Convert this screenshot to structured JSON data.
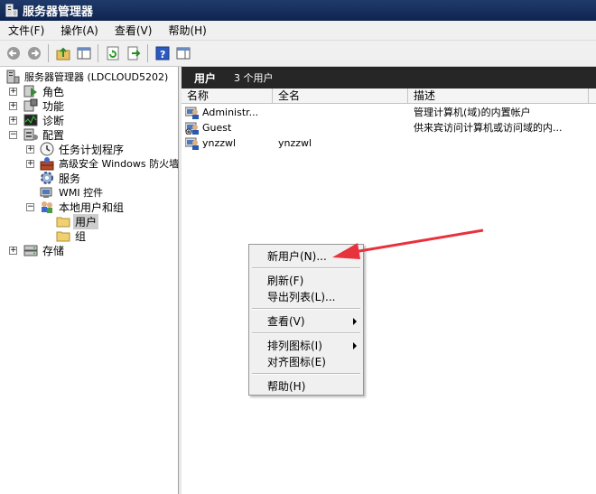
{
  "window": {
    "title": "服务器管理器"
  },
  "menubar": [
    {
      "id": "file",
      "label": "文件(F)"
    },
    {
      "id": "action",
      "label": "操作(A)"
    },
    {
      "id": "view",
      "label": "查看(V)"
    },
    {
      "id": "help",
      "label": "帮助(H)"
    }
  ],
  "toolbar": {
    "buttons": [
      "back-arrow-icon",
      "forward-arrow-icon",
      "up-folder-icon",
      "show-hide-tree-icon",
      "refresh-icon",
      "export-icon",
      "help-icon",
      "properties-icon"
    ]
  },
  "tree": {
    "root": "服务器管理器 (LDCLOUD5202)",
    "items": {
      "roles": "角色",
      "features": "功能",
      "diagnostics": "诊断",
      "configuration": "配置",
      "task_scheduler": "任务计划程序",
      "firewall": "高级安全 Windows 防火墙",
      "services": "服务",
      "wmi": "WMI 控件",
      "local_users_groups": "本地用户和组",
      "users": "用户",
      "groups": "组",
      "storage": "存储"
    }
  },
  "pane": {
    "title": "用户",
    "count": "3 个用户",
    "columns": {
      "name": "名称",
      "fullname": "全名",
      "description": "描述"
    },
    "rows": [
      {
        "name": "Administr...",
        "fullname": "",
        "description": "管理计算机(域)的内置帐户"
      },
      {
        "name": "Guest",
        "fullname": "",
        "description": "供来宾访问计算机或访问域的内..."
      },
      {
        "name": "ynzzwl",
        "fullname": "ynzzwl",
        "description": ""
      }
    ]
  },
  "context_menu": {
    "new_user": "新用户(N)...",
    "refresh": "刷新(F)",
    "export_list": "导出列表(L)...",
    "view": "查看(V)",
    "arrange_icons": "排列图标(I)",
    "line_up_icons": "对齐图标(E)",
    "help": "帮助(H)"
  },
  "colors": {
    "title_bg": "#1f3a6a",
    "pane_header_bg": "#262626",
    "arrow": "#e8323c",
    "selection": "#cdcdcd"
  }
}
